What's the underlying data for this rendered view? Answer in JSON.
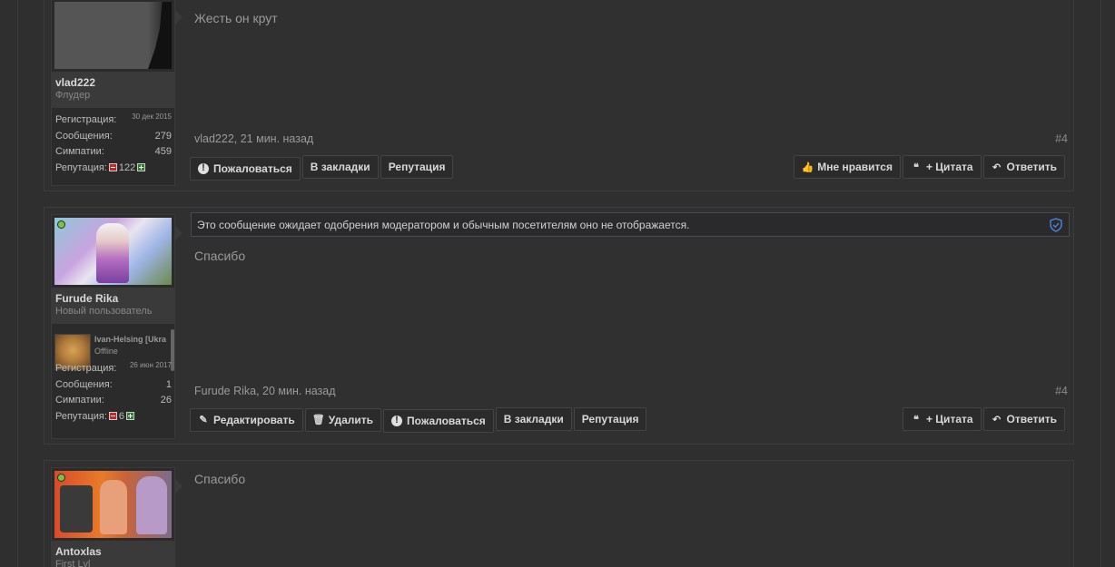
{
  "posts": [
    {
      "user": {
        "name": "vlad222",
        "title": "Флудер",
        "online": false,
        "stats": {
          "registration_label": "Регистрация:",
          "registration_value": "30 дек 2015",
          "messages_label": "Сообщения:",
          "messages_value": "279",
          "likes_label": "Симпатии:",
          "likes_value": "459",
          "reputation_label": "Репутация:",
          "reputation_value": "122"
        }
      },
      "message": "Жесть он крут",
      "meta": "vlad222, 21 мин. назад",
      "post_number": "#4",
      "left_buttons": [
        "Пожаловаться",
        "В закладки",
        "Репутация"
      ],
      "right_buttons": [
        "Мне нравится",
        "+ Цитата",
        "Ответить"
      ]
    },
    {
      "user": {
        "name": "Furude Rika",
        "title": "Новый пользователь",
        "online": true,
        "friend": {
          "name": "Ivan-Helsing [Ukra",
          "status": "Offline"
        },
        "stats": {
          "registration_label": "Регистрация:",
          "registration_value": "26 июн 2017",
          "messages_label": "Сообщения:",
          "messages_value": "1",
          "likes_label": "Симпатии:",
          "likes_value": "26",
          "reputation_label": "Репутация:",
          "reputation_value": "6"
        }
      },
      "moderation_notice": "Это сообщение ожидает одобрения модератором и обычным посетителям оно не отображается.",
      "message": "Спасибо",
      "meta": "Furude Rika, 20 мин. назад",
      "post_number": "#4",
      "left_buttons": [
        "Редактировать",
        "Удалить",
        "Пожаловаться",
        "В закладки",
        "Репутация"
      ],
      "right_buttons": [
        "+ Цитата",
        "Ответить"
      ]
    },
    {
      "user": {
        "name": "Antoxlas",
        "title": "First Lvl",
        "online": true
      },
      "message": "Спасибо"
    }
  ],
  "colors": {
    "background": "#2f2f2f",
    "online": "#7bc142",
    "rep_minus": "#c62828",
    "rep_plus": "#2e7d32",
    "shield": "#4a7fd4"
  }
}
